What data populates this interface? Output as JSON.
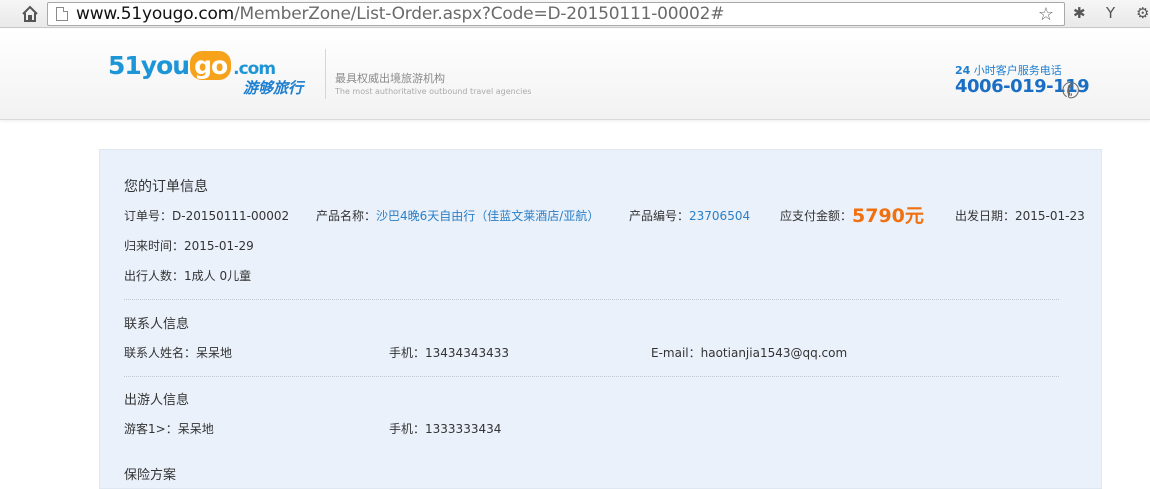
{
  "browser": {
    "url_host": "www.51yougo.com",
    "url_path": "/MemberZone/List-Order.aspx?Code=D-20150111-00002#"
  },
  "header": {
    "logo_main": "51you",
    "logo_go": "go",
    "logo_com": ".com",
    "logo_cn": "游够旅行",
    "slogan_cn": "最具权威出境旅游机构",
    "slogan_en": "The most authoritative outbound travel agencies",
    "hotline_label_prefix": "24",
    "hotline_label": " 小时客户服务电话",
    "hotline_number": "4006-019-119"
  },
  "order": {
    "title": "您的订单信息",
    "order_no_label": "订单号：",
    "order_no": "D-20150111-00002",
    "product_name_label": "产品名称：",
    "product_name": "沙巴4晚6天自由行（佳蓝文莱酒店/亚航）",
    "product_code_label": "产品编号：",
    "product_code": "23706504",
    "amount_label": "应支付金额：",
    "amount": "5790元",
    "depart_label": "出发日期：",
    "depart_date": "2015-01-23",
    "return_label": "归来时间：",
    "return_date": "2015-01-29",
    "travelers_label": "出行人数：",
    "travelers": "1成人 0儿童"
  },
  "contact": {
    "title": "联系人信息",
    "name_label": "联系人姓名：",
    "name": "呆呆地",
    "phone_label": "手机：",
    "phone": "13434343433",
    "email_label": "E-mail：",
    "email": "haotianjia1543@qq.com"
  },
  "travelers_info": {
    "title": "出游人信息",
    "item_label": "游客1>：",
    "item_name": "呆呆地",
    "phone_label": "手机：",
    "phone": "1333333434"
  },
  "insurance": {
    "title": "保险方案"
  }
}
